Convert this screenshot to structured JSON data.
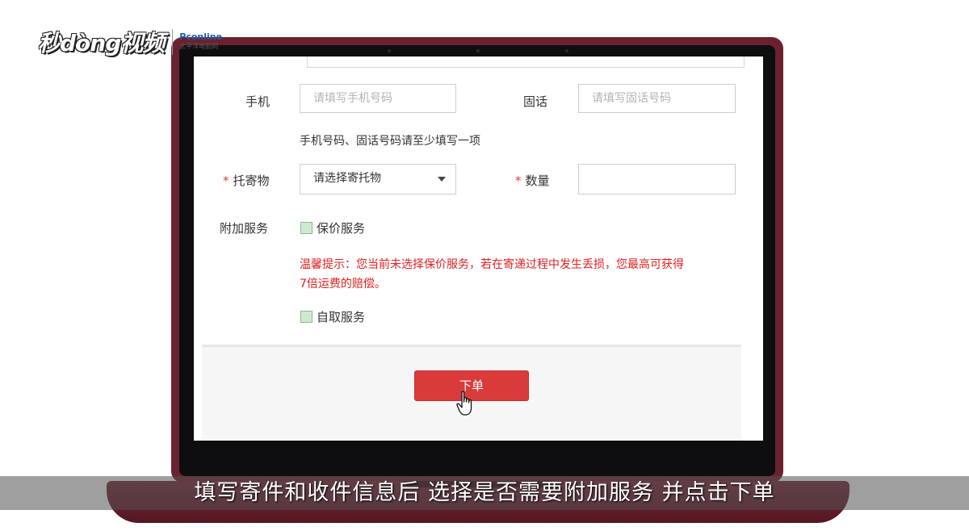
{
  "watermark": {
    "brand": "秒dòng视频",
    "partner": "Pconline",
    "partner_sub": "太平洋电脑网"
  },
  "form": {
    "mobile": {
      "label": "手机",
      "placeholder": "请填写手机号码"
    },
    "landline": {
      "label": "固话",
      "placeholder": "请填写固话号码"
    },
    "phone_hint": "手机号码、固话号码请至少填写一项",
    "item": {
      "required_mark": "*",
      "label": "托寄物",
      "value": "请选择寄托物"
    },
    "quantity": {
      "required_mark": "*",
      "label": "数量",
      "value": ""
    },
    "extra_services": {
      "label": "附加服务",
      "insurance": {
        "label": "保价服务",
        "checked": false
      },
      "warning_line1": "温馨提示：您当前未选择保价服务，若在寄递过程中发生丢损，您最高可获得",
      "warning_line2": "7倍运费的赔偿。",
      "self_pickup": {
        "label": "自取服务",
        "checked": false
      }
    },
    "submit_label": "下单"
  },
  "subtitle": "填写寄件和收件信息后 选择是否需要附加服务 并点击下单",
  "colors": {
    "accent": "#d93b3b",
    "warning": "#e02020",
    "laptop": "#6a2230"
  }
}
